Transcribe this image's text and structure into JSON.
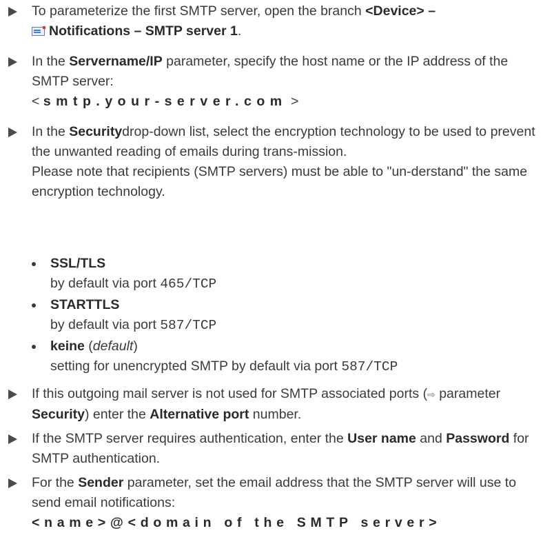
{
  "step1": {
    "text": "To parameterize the first SMTP server, open the branch ",
    "path_part1": "<Device> –",
    "path_part2": "Notifications  – SMTP server 1",
    "end": ".",
    "icon": "notification-envelope-icon"
  },
  "step2": {
    "pre": "In the ",
    "param": "Servername/IP",
    "post": " parameter, specify the host name or the IP address of the SMTP server:",
    "open": "< ",
    "value": "smtp.your-server.com",
    "close": " >"
  },
  "step3": {
    "pre": "In the ",
    "param": "Security",
    "post": "drop-down list, select the encryption technology to be used to prevent the unwanted reading of emails during trans-mission.",
    "note": "Please note that recipients (SMTP servers) must be able to \"un-derstand\" the same encryption technology."
  },
  "options": [
    {
      "name": "SSL/TLS",
      "desc_pre": "by default via port ",
      "port": "465/TCP"
    },
    {
      "name": "STARTTLS",
      "desc_pre": "by default via port ",
      "port": "587/TCP"
    },
    {
      "name": "keine",
      "paren_open": " (",
      "default_label": "default",
      "paren_close": ")",
      "desc_pre": "setting for unencrypted SMTP by default via port ",
      "port": "587/TCP"
    }
  ],
  "step4": {
    "pre": "If this outgoing mail server is not used for SMTP associated ports (",
    "arrow": "⇨",
    "mid1": " parameter ",
    "param": "Security",
    "mid2": ") enter the ",
    "param2": "Alternative port",
    "post": " number."
  },
  "step5": {
    "pre": "If the SMTP server requires authentication, enter the ",
    "user": "User name",
    "and": " and ",
    "pass": "Password",
    "post": " for SMTP authentication."
  },
  "step6": {
    "pre": "For the ",
    "param": "Sender",
    "post": " parameter, set the email address that the SMTP server will use to send email notifications:",
    "value": "<name>@<domain of the SMTP server>"
  }
}
